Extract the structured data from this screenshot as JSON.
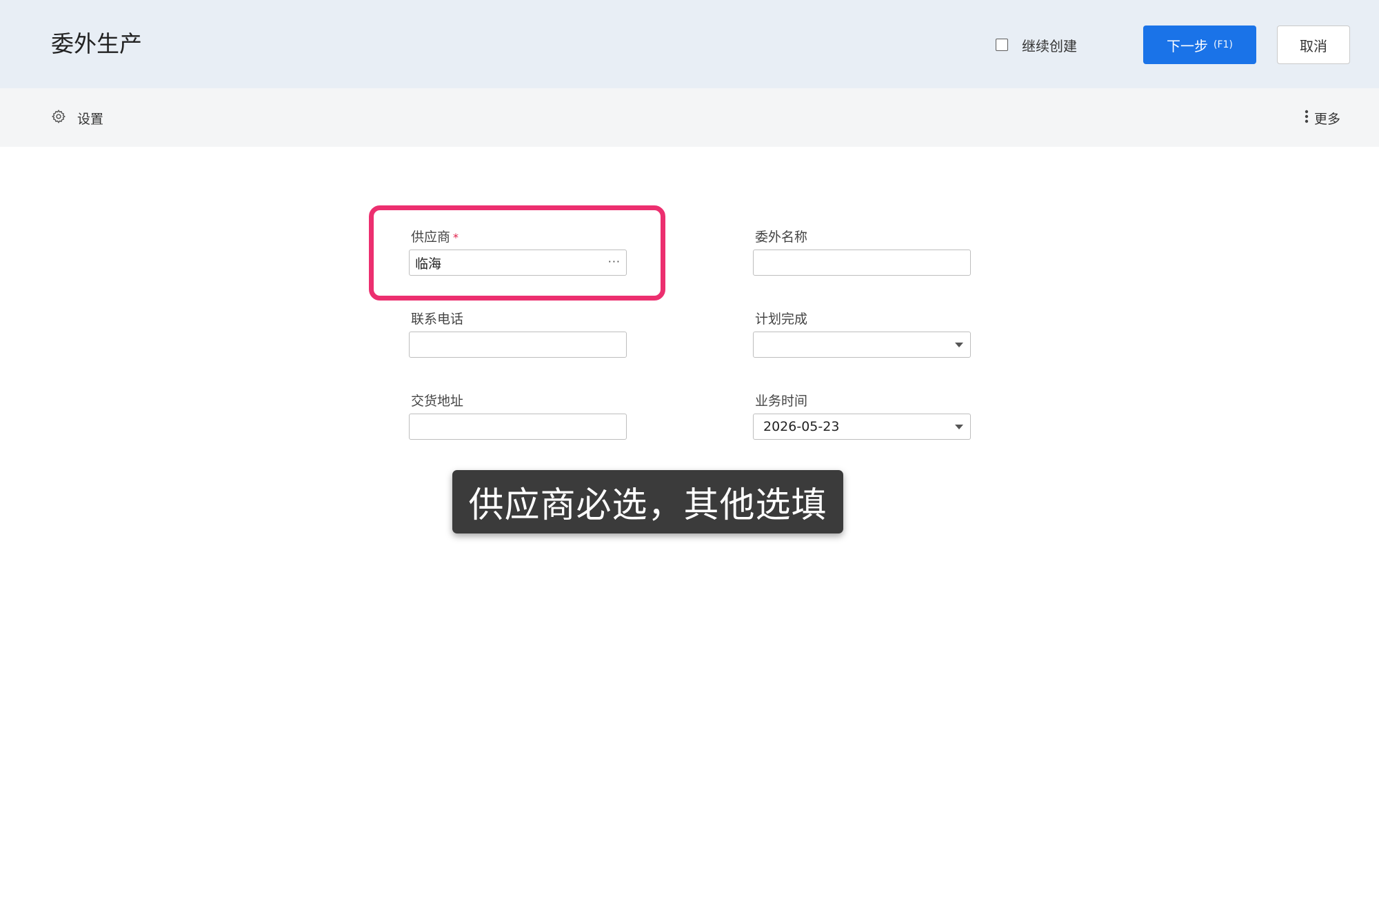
{
  "header": {
    "title": "委外生产",
    "keep_creating_label": "继续创建",
    "keep_creating_checked": false,
    "next_label": "下一步",
    "next_hotkey": "(F1)",
    "cancel_label": "取消",
    "primary_color": "#1a73e8"
  },
  "toolbar": {
    "settings_label": "设置",
    "settings_icon": "gear-icon",
    "more_label": "更多",
    "more_icon": "vertical-dots-icon"
  },
  "form": {
    "supplier": {
      "label": "供应商",
      "required_mark": "*",
      "value": "临海",
      "picker_glyph": "···"
    },
    "contract_name": {
      "label": "委外名称",
      "value": ""
    },
    "phone": {
      "label": "联系电话",
      "value": ""
    },
    "planned_completion": {
      "label": "计划完成",
      "value": ""
    },
    "delivery_address": {
      "label": "交货地址",
      "value": ""
    },
    "business_time": {
      "label": "业务时间",
      "value": "2026-05-23"
    }
  },
  "annotation": {
    "highlight_color": "#ec2f6f",
    "caption": "供应商必选，其他选填"
  }
}
